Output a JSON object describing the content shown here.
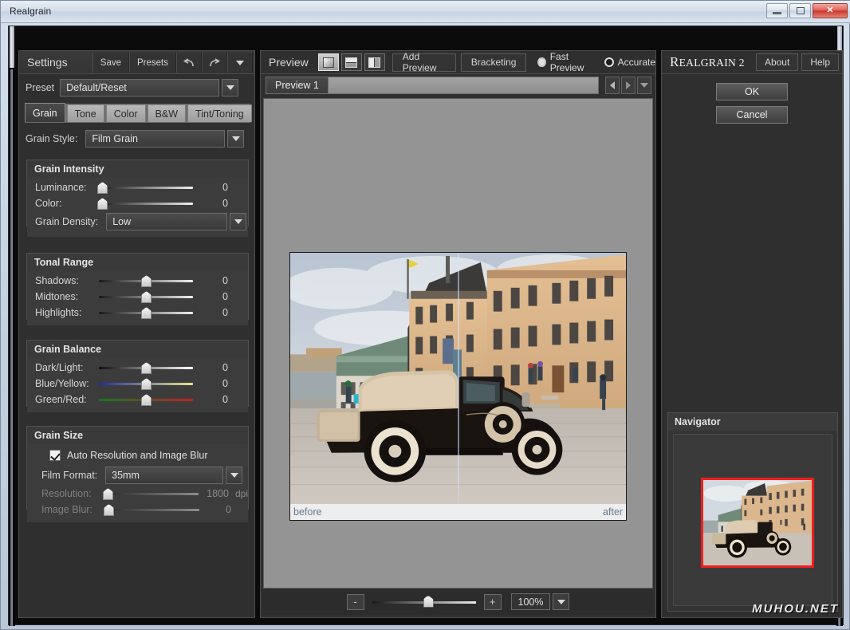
{
  "window": {
    "title": "Realgrain",
    "buttons": {
      "minimize": "minimize-button",
      "maximize": "maximize-button",
      "close": "✕"
    }
  },
  "settings": {
    "title": "Settings",
    "header_buttons": [
      {
        "label": "Save",
        "name": "save-button"
      },
      {
        "label": "Presets",
        "name": "presets-button"
      }
    ],
    "undo_label": "undo-icon",
    "redo_label": "redo-icon",
    "more_label": "chevron-down-icon",
    "preset": {
      "label": "Preset",
      "value": "Default/Reset"
    },
    "tabs": [
      {
        "label": "Grain",
        "active": true
      },
      {
        "label": "Tone",
        "active": false
      },
      {
        "label": "Color",
        "active": false
      },
      {
        "label": "B&W",
        "active": false
      },
      {
        "label": "Tint/Toning",
        "active": false
      }
    ],
    "grain_style": {
      "label": "Grain Style:",
      "value": "Film Grain"
    },
    "groups": [
      {
        "title": "Grain Intensity",
        "rows": [
          {
            "label": "Luminance:",
            "value": "0",
            "thumb_pct": 3,
            "kind": "plain"
          },
          {
            "label": "Color:",
            "value": "0",
            "thumb_pct": 3,
            "kind": "plain"
          }
        ],
        "combo": {
          "label": "Grain Density:",
          "value": "Low"
        }
      },
      {
        "title": "Tonal Range",
        "rows": [
          {
            "label": "Shadows:",
            "value": "0",
            "thumb_pct": 50,
            "kind": "plain"
          },
          {
            "label": "Midtones:",
            "value": "0",
            "thumb_pct": 50,
            "kind": "plain"
          },
          {
            "label": "Highlights:",
            "value": "0",
            "thumb_pct": 50,
            "kind": "plain"
          }
        ]
      },
      {
        "title": "Grain Balance",
        "rows": [
          {
            "label": "Dark/Light:",
            "value": "0",
            "thumb_pct": 50,
            "kind": "bw"
          },
          {
            "label": "Blue/Yellow:",
            "value": "0",
            "thumb_pct": 50,
            "kind": "by"
          },
          {
            "label": "Green/Red:",
            "value": "0",
            "thumb_pct": 50,
            "kind": "gr"
          }
        ]
      },
      {
        "title": "Grain Size",
        "checkbox": {
          "label": "Auto Resolution and Image Blur",
          "checked": true
        },
        "combo": {
          "label": "Film Format:",
          "value": "35mm"
        },
        "rows": [
          {
            "label": "Resolution:",
            "value": "1800",
            "unit": "dpi",
            "thumb_pct": 3,
            "kind": "dimmed",
            "disabled": true
          },
          {
            "label": "Image Blur:",
            "value": "0",
            "unit": "",
            "thumb_pct": 3,
            "kind": "dimmed",
            "disabled": true
          }
        ]
      }
    ]
  },
  "preview": {
    "title": "Preview",
    "view_modes": [
      {
        "name": "view-single",
        "active": true
      },
      {
        "name": "view-split-horizontal",
        "active": false
      },
      {
        "name": "view-split-vertical",
        "active": false
      }
    ],
    "add_preview_label": "Add Preview",
    "bracketing_label": "Bracketing",
    "quality_options": [
      {
        "label": "Fast Preview",
        "selected": true
      },
      {
        "label": "Accurate",
        "selected": false
      }
    ],
    "tabs": [
      {
        "label": "Preview 1",
        "active": true
      }
    ],
    "nav": {
      "prev": "prev-icon",
      "next": "next-icon",
      "menu": "chevron-down-icon"
    },
    "image_labels": {
      "before": "before",
      "after": "after"
    },
    "zoom": {
      "minus": "-",
      "plus": "+",
      "value": "100%",
      "thumb_pct": 50
    }
  },
  "right_panel": {
    "brand_first": "R",
    "brand_bold": "EAL",
    "brand_rest": "GRAIN 2",
    "about_label": "About",
    "help_label": "Help",
    "ok_label": "OK",
    "cancel_label": "Cancel",
    "navigator_title": "Navigator",
    "watermark": "MUHOU.NET"
  },
  "colors": {
    "panel_bg": "#2f2f2f",
    "group_bg": "#3c3c3c",
    "text": "#d6d6d6",
    "accent_red": "#ee1f1f",
    "canvas_gray": "#949494"
  }
}
